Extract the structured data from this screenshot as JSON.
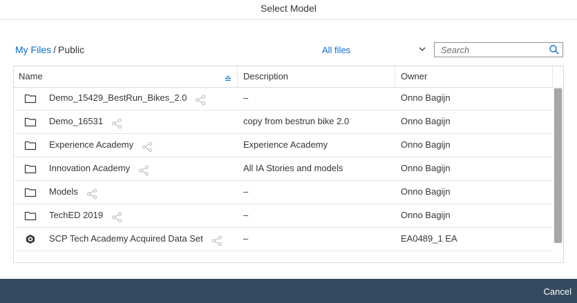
{
  "dialog": {
    "title": "Select Model"
  },
  "breadcrumb": {
    "root": "My Files",
    "separator": "/",
    "current": "Public"
  },
  "filter": {
    "selected": "All files"
  },
  "search": {
    "placeholder": "Search",
    "value": ""
  },
  "table": {
    "columns": {
      "name": "Name",
      "description": "Description",
      "owner": "Owner"
    },
    "sort": {
      "column": "name",
      "direction": "ascending"
    },
    "rows": [
      {
        "icon": "folder-icon",
        "name": "Demo_15429_BestRun_Bikes_2.0",
        "description": "–",
        "owner": "Onno Bagijn"
      },
      {
        "icon": "folder-icon",
        "name": "Demo_16531",
        "description": "copy from bestrun bike 2.0",
        "owner": "Onno Bagijn"
      },
      {
        "icon": "folder-icon",
        "name": "Experience Academy",
        "description": "Experience Academy",
        "owner": "Onno Bagijn"
      },
      {
        "icon": "folder-icon",
        "name": "Innovation Academy",
        "description": "All IA Stories and models",
        "owner": "Onno Bagijn"
      },
      {
        "icon": "folder-icon",
        "name": "Models",
        "description": "–",
        "owner": "Onno Bagijn"
      },
      {
        "icon": "folder-icon",
        "name": "TechED 2019",
        "description": "–",
        "owner": "Onno Bagijn"
      },
      {
        "icon": "dataset-icon",
        "name": "SCP Tech Academy Acquired Data Set",
        "description": "–",
        "owner": "EA0489_1 EA"
      }
    ]
  },
  "footer": {
    "cancel_label": "Cancel"
  },
  "colors": {
    "link": "#0a6ed1",
    "footer_bg": "#354a5f",
    "text": "#32363a"
  }
}
